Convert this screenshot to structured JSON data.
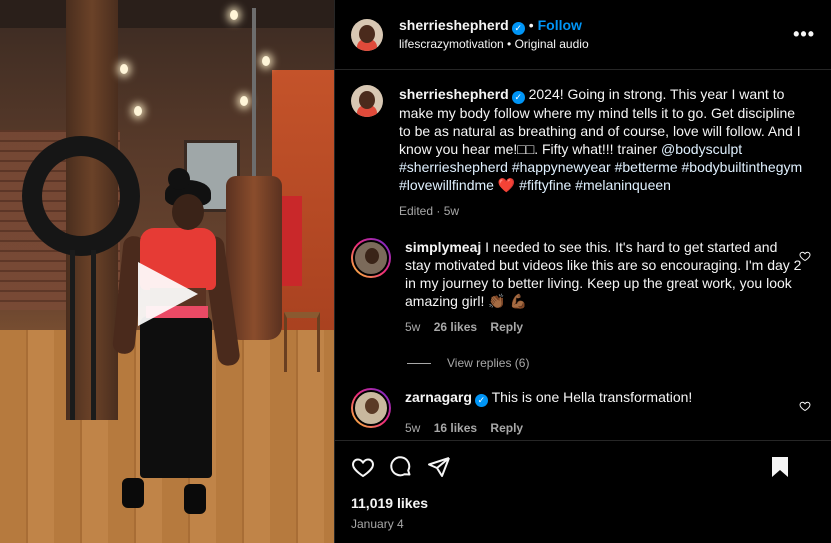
{
  "post": {
    "username": "sherrieshepherd",
    "follow_label": "Follow",
    "audio_line": "lifescrazymotivation • Original audio",
    "caption_text": "2024! Going in strong. This year I want to make my body follow where my mind tells it to go. Get discipline to be as natural as breathing and of course, love will follow. And I know you hear me!□□. Fifty what!!! trainer ",
    "caption_mention": "@bodysculpt",
    "caption_tags_1": "#sherrieshepherd #happynewyear #betterme #bodybuiltinthegym",
    "caption_tags_2": "#lovewillfindme",
    "caption_heart": "❤️",
    "caption_tags_3": "#fiftyfine #melaninqueen",
    "caption_meta": "Edited · 5w"
  },
  "comments": [
    {
      "username": "simplymeaj",
      "text": "I needed to see this. It's hard to get started and stay motivated but videos like this are so encouraging. I'm day 2 in my journey to better living. Keep up the great work, you look amazing girl! 👏🏾 💪🏾",
      "time": "5w",
      "likes": "26 likes",
      "reply": "Reply",
      "view_replies": "View replies (6)"
    },
    {
      "username": "zarnagarg",
      "text": "This is one Hella transformation!",
      "time": "5w",
      "likes": "16 likes",
      "reply": "Reply"
    }
  ],
  "footer": {
    "likes": "11,019 likes",
    "date": "January 4"
  },
  "icons": {
    "like": "heart-icon",
    "comment": "comment-icon",
    "share": "share-icon",
    "save": "bookmark-icon",
    "more": "more-options-icon"
  },
  "colors": {
    "accent": "#0095f6",
    "background": "#000000",
    "muted": "#a8a8a8"
  }
}
